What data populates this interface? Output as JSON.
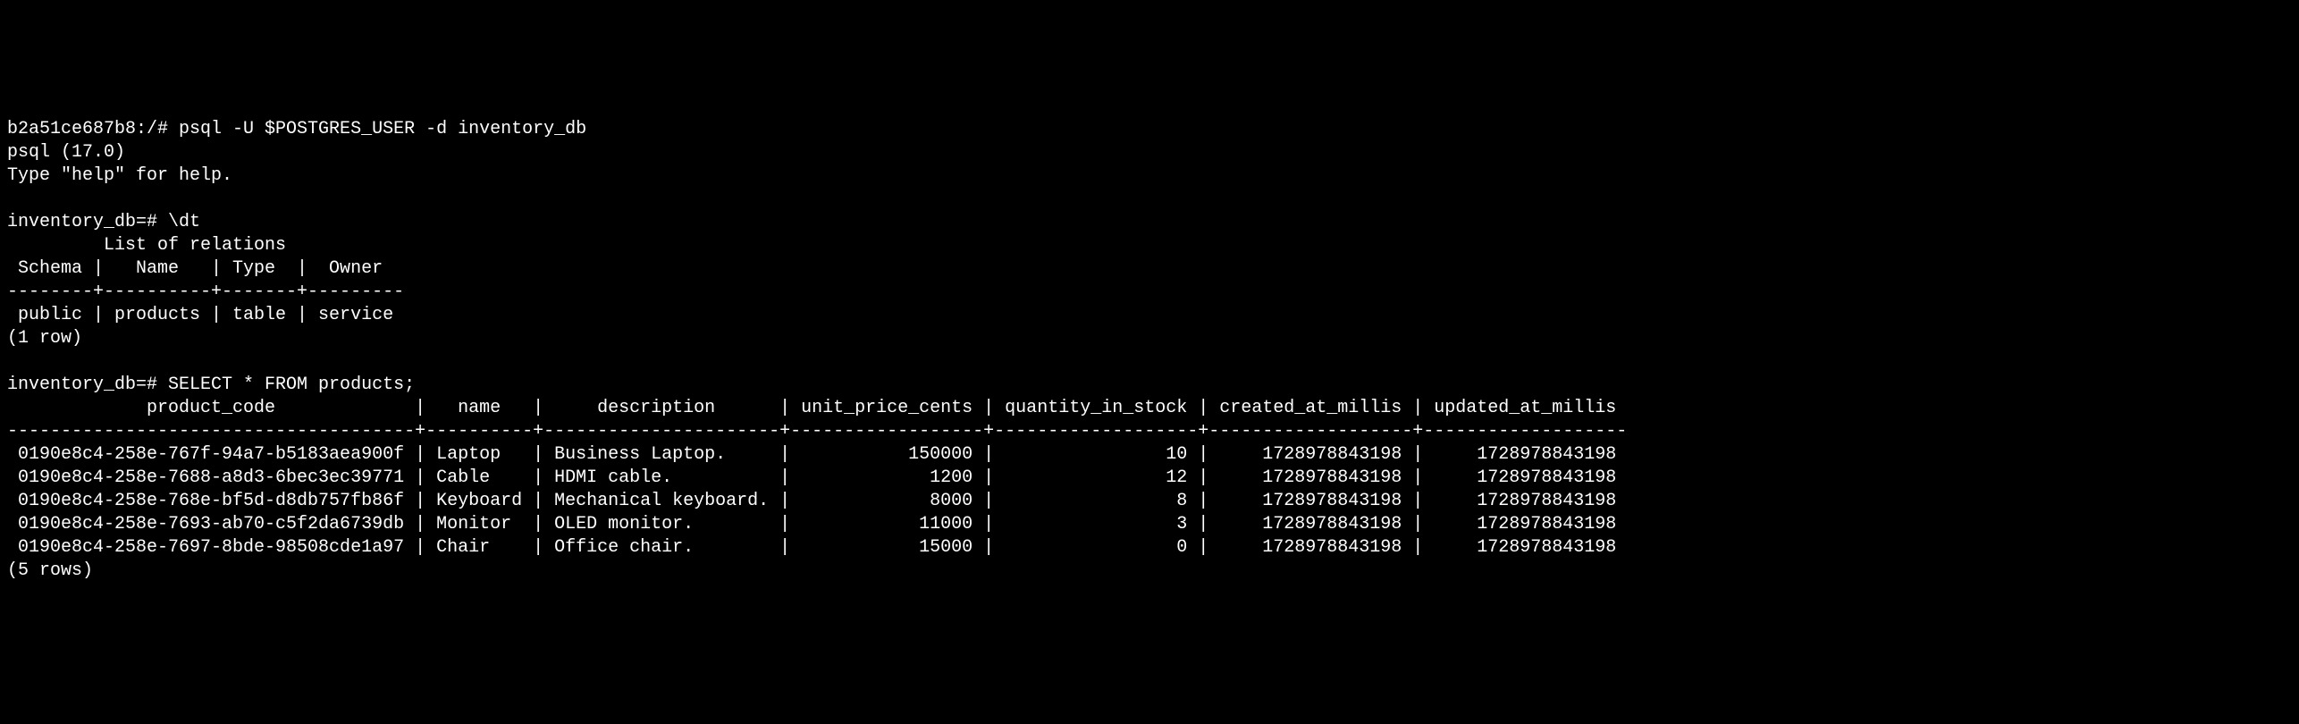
{
  "lines": {
    "l0": "b2a51ce687b8:/# psql -U $POSTGRES_USER -d inventory_db",
    "l1": "psql (17.0)",
    "l2": "Type \"help\" for help.",
    "l3": "",
    "l4": "inventory_db=# \\dt",
    "l5": "         List of relations",
    "l6": " Schema |   Name   | Type  |  Owner  ",
    "l7": "--------+----------+-------+---------",
    "l8": " public | products | table | service",
    "l9": "(1 row)",
    "l10": "",
    "l11": "inventory_db=# SELECT * FROM products;",
    "l12": "             product_code             |   name   |     description      | unit_price_cents | quantity_in_stock | created_at_millis | updated_at_millis ",
    "l13": "--------------------------------------+----------+----------------------+------------------+-------------------+-------------------+-------------------",
    "l14": " 0190e8c4-258e-767f-94a7-b5183aea900f | Laptop   | Business Laptop.     |           150000 |                10 |     1728978843198 |     1728978843198",
    "l15": " 0190e8c4-258e-7688-a8d3-6bec3ec39771 | Cable    | HDMI cable.          |             1200 |                12 |     1728978843198 |     1728978843198",
    "l16": " 0190e8c4-258e-768e-bf5d-d8db757fb86f | Keyboard | Mechanical keyboard. |             8000 |                 8 |     1728978843198 |     1728978843198",
    "l17": " 0190e8c4-258e-7693-ab70-c5f2da6739db | Monitor  | OLED monitor.        |            11000 |                 3 |     1728978843198 |     1728978843198",
    "l18": " 0190e8c4-258e-7697-8bde-98508cde1a97 | Chair    | Office chair.        |            15000 |                 0 |     1728978843198 |     1728978843198",
    "l19": "(5 rows)",
    "l20": ""
  },
  "shell_prompt": "b2a51ce687b8:/#",
  "psql_version": "17.0",
  "db_name": "inventory_db",
  "relations": {
    "title": "List of relations",
    "headers": [
      "Schema",
      "Name",
      "Type",
      "Owner"
    ],
    "rows": [
      {
        "schema": "public",
        "name": "products",
        "type": "table",
        "owner": "service"
      }
    ],
    "count_text": "(1 row)"
  },
  "query": "SELECT * FROM products;",
  "products": {
    "headers": [
      "product_code",
      "name",
      "description",
      "unit_price_cents",
      "quantity_in_stock",
      "created_at_millis",
      "updated_at_millis"
    ],
    "rows": [
      {
        "product_code": "0190e8c4-258e-767f-94a7-b5183aea900f",
        "name": "Laptop",
        "description": "Business Laptop.",
        "unit_price_cents": 150000,
        "quantity_in_stock": 10,
        "created_at_millis": 1728978843198,
        "updated_at_millis": 1728978843198
      },
      {
        "product_code": "0190e8c4-258e-7688-a8d3-6bec3ec39771",
        "name": "Cable",
        "description": "HDMI cable.",
        "unit_price_cents": 1200,
        "quantity_in_stock": 12,
        "created_at_millis": 1728978843198,
        "updated_at_millis": 1728978843198
      },
      {
        "product_code": "0190e8c4-258e-768e-bf5d-d8db757fb86f",
        "name": "Keyboard",
        "description": "Mechanical keyboard.",
        "unit_price_cents": 8000,
        "quantity_in_stock": 8,
        "created_at_millis": 1728978843198,
        "updated_at_millis": 1728978843198
      },
      {
        "product_code": "0190e8c4-258e-7693-ab70-c5f2da6739db",
        "name": "Monitor",
        "description": "OLED monitor.",
        "unit_price_cents": 11000,
        "quantity_in_stock": 3,
        "created_at_millis": 1728978843198,
        "updated_at_millis": 1728978843198
      },
      {
        "product_code": "0190e8c4-258e-7697-8bde-98508cde1a97",
        "name": "Chair",
        "description": "Office chair.",
        "unit_price_cents": 15000,
        "quantity_in_stock": 0,
        "created_at_millis": 1728978843198,
        "updated_at_millis": 1728978843198
      }
    ],
    "count_text": "(5 rows)"
  }
}
